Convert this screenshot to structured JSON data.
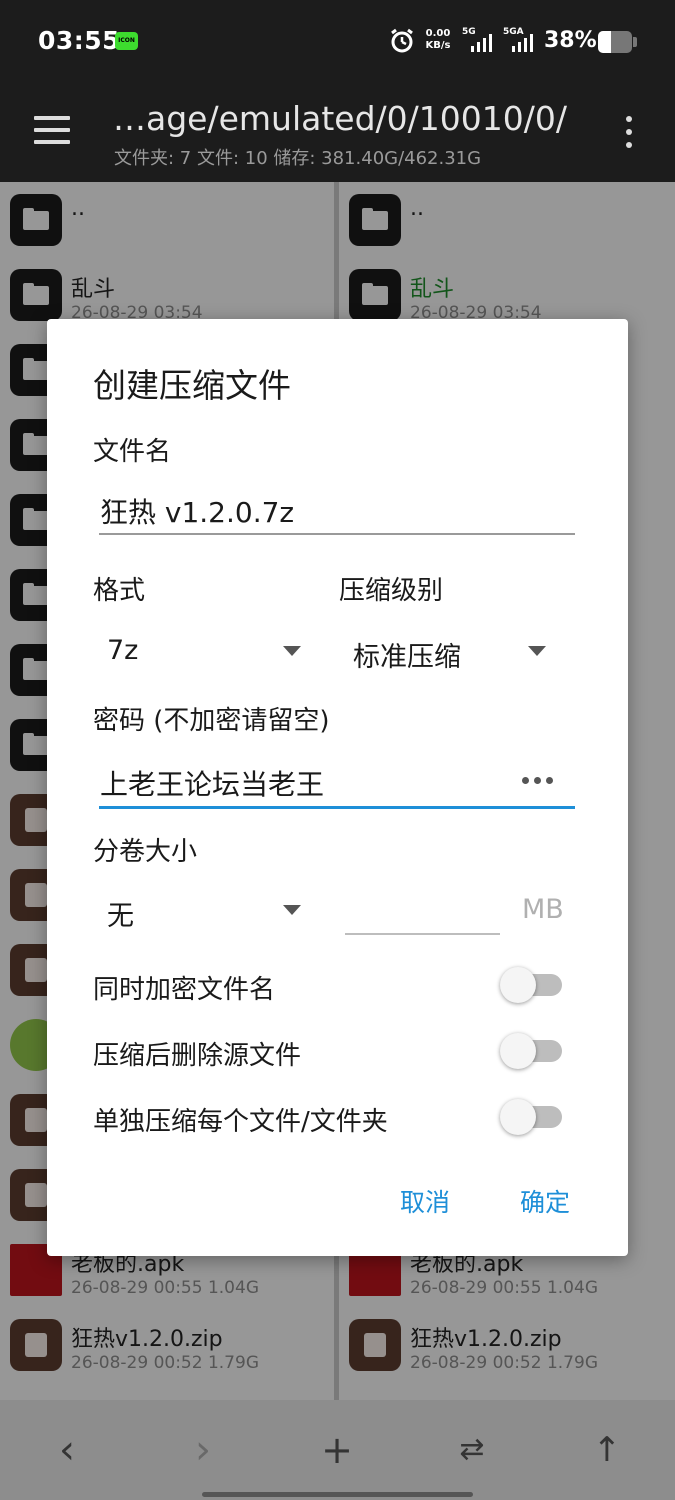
{
  "status_bar": {
    "time": "03:55",
    "badge": "ICON",
    "speed_value": "0.00",
    "speed_unit": "KB/s",
    "net1": "5G",
    "net2": "5GA",
    "battery_text": "38%",
    "battery_level": 0.38
  },
  "toolbar": {
    "path": "…age/emulated/0/10010/0/",
    "info": "文件夹: 7  文件: 10  储存: 381.40G/462.31G"
  },
  "left_pane": {
    "items": [
      {
        "name": "..",
        "meta": "",
        "type": "folder"
      },
      {
        "name": "乱斗",
        "meta": "26-08-29 03:54",
        "type": "folder"
      }
    ],
    "bottom_items": [
      {
        "name": "老板的.apk",
        "meta": "26-08-29 00:55  1.04G",
        "type": "apk"
      },
      {
        "name": "狂热v1.2.0.zip",
        "meta": "26-08-29 00:52  1.79G",
        "type": "archive"
      }
    ]
  },
  "right_pane": {
    "items": [
      {
        "name": "..",
        "meta": "",
        "type": "folder"
      },
      {
        "name": "乱斗",
        "meta": "26-08-29 03:54",
        "type": "folder"
      }
    ],
    "bottom_items": [
      {
        "name": "老板的.apk",
        "meta": "26-08-29 00:55  1.04G",
        "type": "apk"
      },
      {
        "name": "狂热v1.2.0.zip",
        "meta": "26-08-29 00:52  1.79G",
        "type": "archive"
      }
    ]
  },
  "bottom_bar": {
    "back": "‹",
    "forward": "›",
    "add": "+",
    "swap": "⇄",
    "up": "↑"
  },
  "dialog": {
    "title": "创建压缩文件",
    "filename_label": "文件名",
    "filename_value": "狂热 v1.2.0.7z",
    "format_label": "格式",
    "format_value": "7z",
    "level_label": "压缩级别",
    "level_value": "标准压缩",
    "password_label": "密码 (不加密请留空)",
    "password_value": "上老王论坛当老王",
    "split_label": "分卷大小",
    "split_value": "无",
    "split_unit": "MB",
    "toggle_encrypt_names": "同时加密文件名",
    "toggle_delete_source": "压缩后删除源文件",
    "toggle_separate": "单独压缩每个文件/文件夹",
    "cancel": "取消",
    "ok": "确定"
  },
  "colors": {
    "accent": "#1e8fd8",
    "highlight_name": "#1e8a2a",
    "toolbar_bg": "#1c1c1c"
  }
}
